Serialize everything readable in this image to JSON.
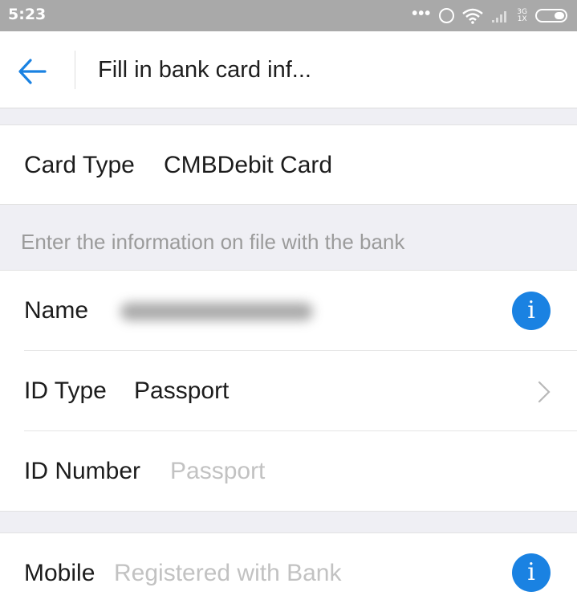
{
  "status_bar": {
    "time": "5:23",
    "dots": "•••",
    "network_top": "3G",
    "network_bottom": "1X"
  },
  "header": {
    "title": "Fill in bank card inf...",
    "back_icon": "arrow-left-icon"
  },
  "card_type": {
    "label": "Card Type",
    "value": "CMBDebit Card"
  },
  "hint": "Enter the information on file with the bank",
  "fields": {
    "name": {
      "label": "Name",
      "info_icon": "info-icon"
    },
    "id_type": {
      "label": "ID Type",
      "value": "Passport",
      "chevron_icon": "chevron-right-icon"
    },
    "id_number": {
      "label": "ID Number",
      "placeholder": "Passport"
    },
    "mobile": {
      "label": "Mobile",
      "placeholder": "Registered with Bank",
      "info_icon": "info-icon"
    }
  },
  "info_glyph": "i",
  "colors": {
    "accent": "#1a82e2",
    "status_bar": "#a9a9a9",
    "page_bg": "#efeff4",
    "placeholder": "#c2c2c2"
  }
}
